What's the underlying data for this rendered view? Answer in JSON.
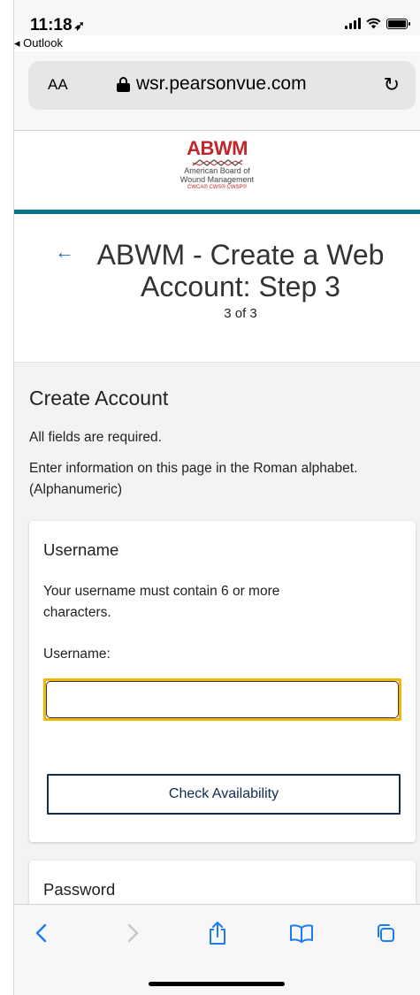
{
  "status_bar": {
    "time": "11:18",
    "back_app": "◂ Outlook"
  },
  "browser": {
    "text_size_label": "AA",
    "url": "wsr.pearsonvue.com",
    "reload_icon": "reload-icon"
  },
  "header": {
    "logo_title": "ABWM",
    "logo_subtitle_line1": "American Board of",
    "logo_subtitle_line2": "Wound Management",
    "logo_credentials": "CWCA® CWS® CWSP®",
    "accent_color": "#0a7389",
    "brand_color": "#c0272d"
  },
  "page": {
    "title": "ABWM - Create a Web Account: Step 3",
    "step_count": "3 of 3"
  },
  "form": {
    "section_title": "Create Account",
    "required_note": "All fields are required.",
    "alphabet_note": "Enter information on this page in the Roman alphabet. (Alphanumeric)",
    "username_card": {
      "heading": "Username",
      "description": "Your username must contain 6 or more characters.",
      "field_label": "Username:",
      "value": "",
      "check_button": "Check Availability"
    },
    "password_card": {
      "heading": "Password"
    }
  },
  "toolbar": {
    "icons": [
      "back-icon",
      "forward-icon",
      "share-icon",
      "bookmarks-icon",
      "tabs-icon"
    ]
  }
}
